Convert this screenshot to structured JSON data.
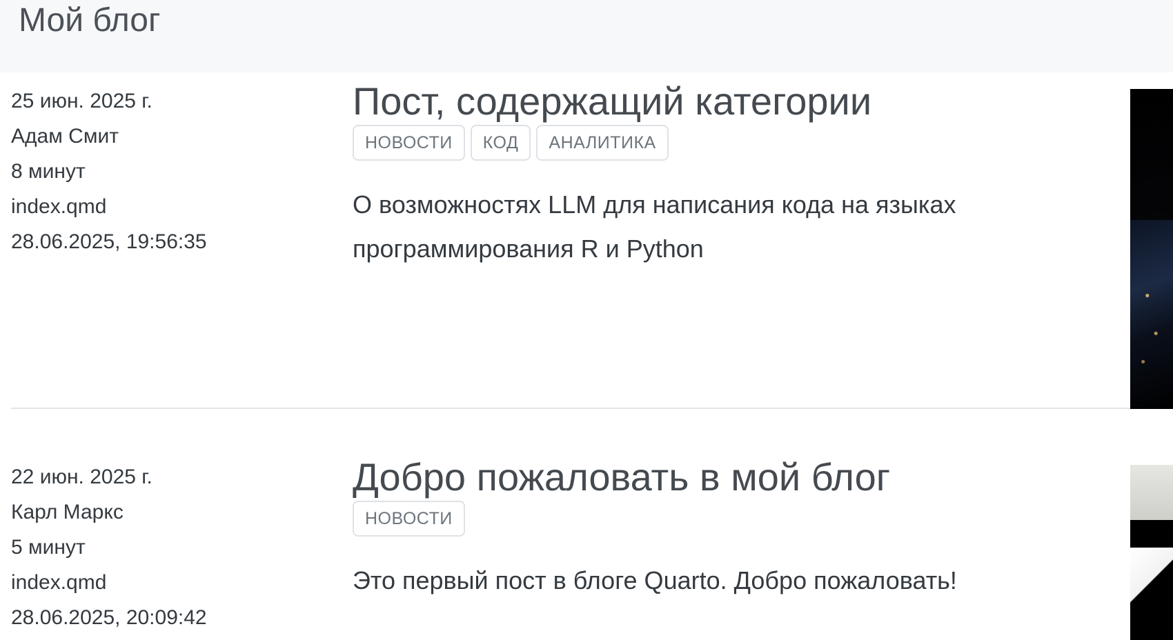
{
  "header": {
    "site_title": "Мой блог"
  },
  "posts": [
    {
      "date": "25 июн. 2025 г.",
      "author": "Адам Смит",
      "reading_time": "8 минут",
      "file": "index.qmd",
      "modified": "28.06.2025, 19:56:35",
      "title": "Пост, содержащий категории",
      "categories": [
        "НОВОСТИ",
        "КОД",
        "АНАЛИТИКА"
      ],
      "description": "О возможностях LLM для написания кода на языках программирования R и Python"
    },
    {
      "date": "22 июн. 2025 г.",
      "author": "Карл Маркс",
      "reading_time": "5 минут",
      "file": "index.qmd",
      "modified": "28.06.2025, 20:09:42",
      "title": "Добро пожаловать в мой блог",
      "categories": [
        "НОВОСТИ"
      ],
      "description": "Это первый пост в блоге Quarto. Добро пожаловать!"
    }
  ]
}
